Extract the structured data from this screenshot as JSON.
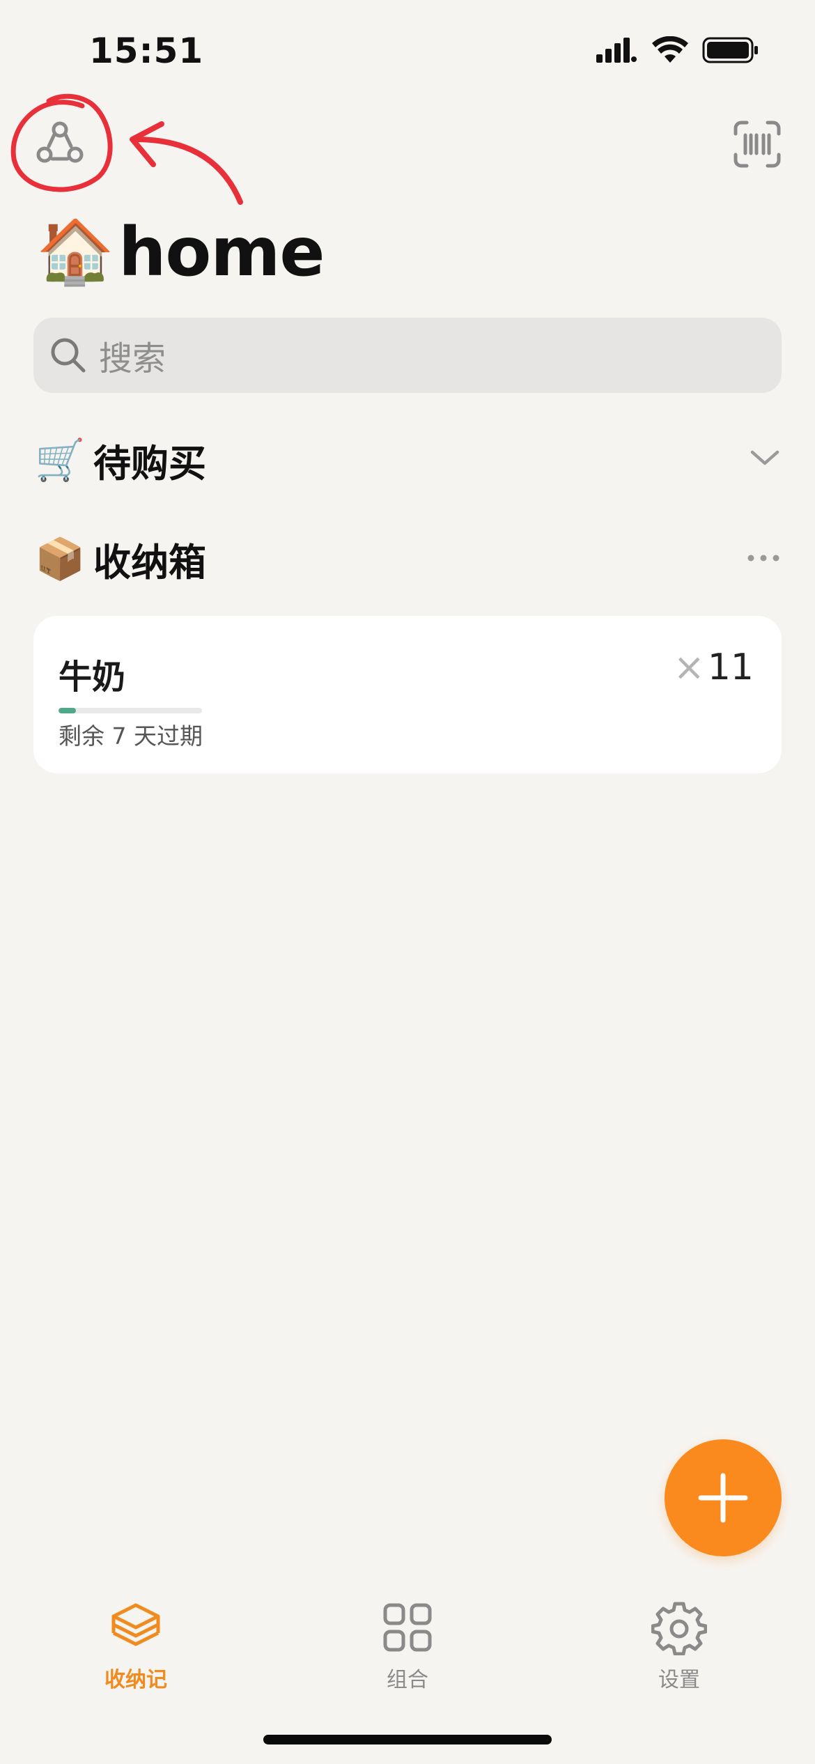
{
  "status_bar": {
    "time": "15:51",
    "icons": [
      "cellular-signal-icon",
      "wifi-icon",
      "battery-icon"
    ]
  },
  "top_bar": {
    "share_icon": "share-icon",
    "scan_icon": "barcode-scan-icon"
  },
  "header": {
    "emoji": "🏠",
    "title": "home"
  },
  "search": {
    "placeholder": "搜索",
    "icon": "search-icon"
  },
  "sections": {
    "shopping": {
      "emoji": "🛒",
      "label": "待购买",
      "icon": "chevron-down-icon"
    },
    "storage": {
      "emoji": "📦",
      "label": "收纳箱",
      "icon": "more-icon"
    }
  },
  "items": [
    {
      "name": "牛奶",
      "count_prefix": "×",
      "count": "11",
      "expiry": "剩余 7 天过期",
      "progress": 0.12
    }
  ],
  "fab": {
    "icon": "plus-icon"
  },
  "tab_bar": {
    "tabs": [
      {
        "label": "收纳记",
        "icon": "layers-icon",
        "active": true
      },
      {
        "label": "组合",
        "icon": "grid-icon",
        "active": false
      },
      {
        "label": "设置",
        "icon": "gear-icon",
        "active": false
      }
    ]
  },
  "colors": {
    "background": "#f6f4f1",
    "accent": "#fa8a1e",
    "progress": "#4fa88a",
    "annotation": "#e8303a"
  }
}
